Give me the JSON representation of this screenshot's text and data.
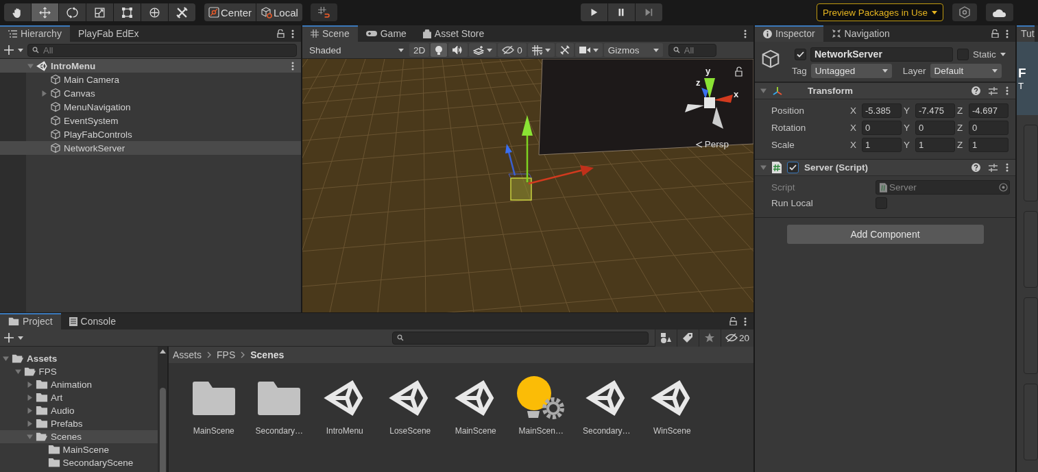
{
  "toolbar": {
    "tools": [
      {
        "kind": "hand",
        "selected": false
      },
      {
        "kind": "move",
        "selected": true
      },
      {
        "kind": "rotate",
        "selected": false
      },
      {
        "kind": "scale",
        "selected": false
      },
      {
        "kind": "rect",
        "selected": false
      },
      {
        "kind": "transform",
        "selected": false
      },
      {
        "kind": "custom",
        "selected": false
      }
    ],
    "pivot_buttons": [
      {
        "kind": "pivot",
        "label": "Center"
      },
      {
        "kind": "space",
        "label": "Local"
      }
    ],
    "play_buttons": [
      {
        "kind": "play"
      },
      {
        "kind": "pause"
      },
      {
        "kind": "step"
      }
    ],
    "preview_packages": "Preview Packages in Use"
  },
  "hierarchy": {
    "tabs": [
      {
        "label": "Hierarchy",
        "selected": true
      },
      {
        "label": "PlayFab EdEx",
        "selected": false
      }
    ],
    "search_placeholder": "All",
    "scene": {
      "name": "IntroMenu",
      "expanded": true,
      "children": [
        {
          "name": "Main Camera",
          "expandable": false,
          "selected": false
        },
        {
          "name": "Canvas",
          "expandable": true,
          "selected": false
        },
        {
          "name": "MenuNavigation",
          "expandable": false,
          "selected": false
        },
        {
          "name": "EventSystem",
          "expandable": false,
          "selected": false
        },
        {
          "name": "PlayFabControls",
          "expandable": false,
          "selected": false
        },
        {
          "name": "NetworkServer",
          "expandable": false,
          "selected": true
        }
      ]
    }
  },
  "scene_view": {
    "tabs": [
      {
        "kind": "scene",
        "label": "Scene",
        "selected": true
      },
      {
        "kind": "game",
        "label": "Game",
        "selected": false
      },
      {
        "kind": "store",
        "label": "Asset Store",
        "selected": false
      }
    ],
    "shading": "Shaded",
    "mode_2d": "2D",
    "hidden_count": "0",
    "gizmos": "Gizmos",
    "search_placeholder": "All",
    "view_label": "Persp",
    "axes": [
      "y",
      "z",
      "x"
    ]
  },
  "inspector": {
    "tabs": [
      {
        "kind": "info",
        "label": "Inspector",
        "selected": true
      },
      {
        "kind": "navigation",
        "label": "Navigation",
        "selected": false
      }
    ],
    "object": {
      "active": true,
      "name": "NetworkServer",
      "static": false,
      "static_label": "Static",
      "tag_label": "Tag",
      "tag": "Untagged",
      "layer_label": "Layer",
      "layer": "Default"
    },
    "transform": {
      "title": "Transform",
      "expanded": true,
      "rows": [
        {
          "label": "Position",
          "values": [
            {
              "axis": "X",
              "value": "-5.385"
            },
            {
              "axis": "Y",
              "value": "-7.475"
            },
            {
              "axis": "Z",
              "value": "-4.697"
            }
          ]
        },
        {
          "label": "Rotation",
          "values": [
            {
              "axis": "X",
              "value": "0"
            },
            {
              "axis": "Y",
              "value": "0"
            },
            {
              "axis": "Z",
              "value": "0"
            }
          ]
        },
        {
          "label": "Scale",
          "values": [
            {
              "axis": "X",
              "value": "1"
            },
            {
              "axis": "Y",
              "value": "1"
            },
            {
              "axis": "Z",
              "value": "1"
            }
          ]
        }
      ]
    },
    "script_component": {
      "title": "Server (Script)",
      "enabled": true,
      "expanded": true,
      "fields": [
        {
          "kind": "object",
          "label": "Script",
          "value": "Server",
          "disabled": true
        },
        {
          "kind": "toggle",
          "label": "Run Local",
          "checked": false,
          "disabled": false
        }
      ]
    },
    "add_component": "Add Component"
  },
  "project": {
    "tabs": [
      {
        "kind": "folder",
        "label": "Project",
        "selected": true
      },
      {
        "kind": "console",
        "label": "Console",
        "selected": false
      }
    ],
    "hidden_count": "20",
    "tree": [
      {
        "name": "Assets",
        "expandable": true,
        "expanded": true,
        "selected": false,
        "children": [
          {
            "name": "FPS",
            "expandable": true,
            "expanded": true,
            "selected": false,
            "children": [
              {
                "name": "Animation",
                "expandable": true,
                "expanded": false,
                "selected": false
              },
              {
                "name": "Art",
                "expandable": true,
                "expanded": false,
                "selected": false
              },
              {
                "name": "Audio",
                "expandable": true,
                "expanded": false,
                "selected": false
              },
              {
                "name": "Prefabs",
                "expandable": true,
                "expanded": false,
                "selected": false
              },
              {
                "name": "Scenes",
                "expandable": true,
                "expanded": true,
                "selected": true,
                "children": [
                  {
                    "name": "MainScene",
                    "expandable": false,
                    "selected": false
                  },
                  {
                    "name": "SecondaryScene",
                    "expandable": false,
                    "selected": false
                  }
                ]
              }
            ]
          }
        ]
      }
    ],
    "breadcrumb": [
      "Assets",
      "FPS",
      "Scenes"
    ],
    "assets": [
      {
        "kind": "folder",
        "label": "MainScene"
      },
      {
        "kind": "folder",
        "label": "Secondary…"
      },
      {
        "kind": "scene",
        "label": "IntroMenu"
      },
      {
        "kind": "scene",
        "label": "LoseScene"
      },
      {
        "kind": "scene",
        "label": "MainScene"
      },
      {
        "kind": "lighting",
        "label": "MainScen…"
      },
      {
        "kind": "scene",
        "label": "Secondary…"
      },
      {
        "kind": "scene",
        "label": "WinScene"
      }
    ]
  },
  "side_panel": {
    "tab": "Tut",
    "banner_title": "F",
    "banner_subtitle": "T"
  }
}
